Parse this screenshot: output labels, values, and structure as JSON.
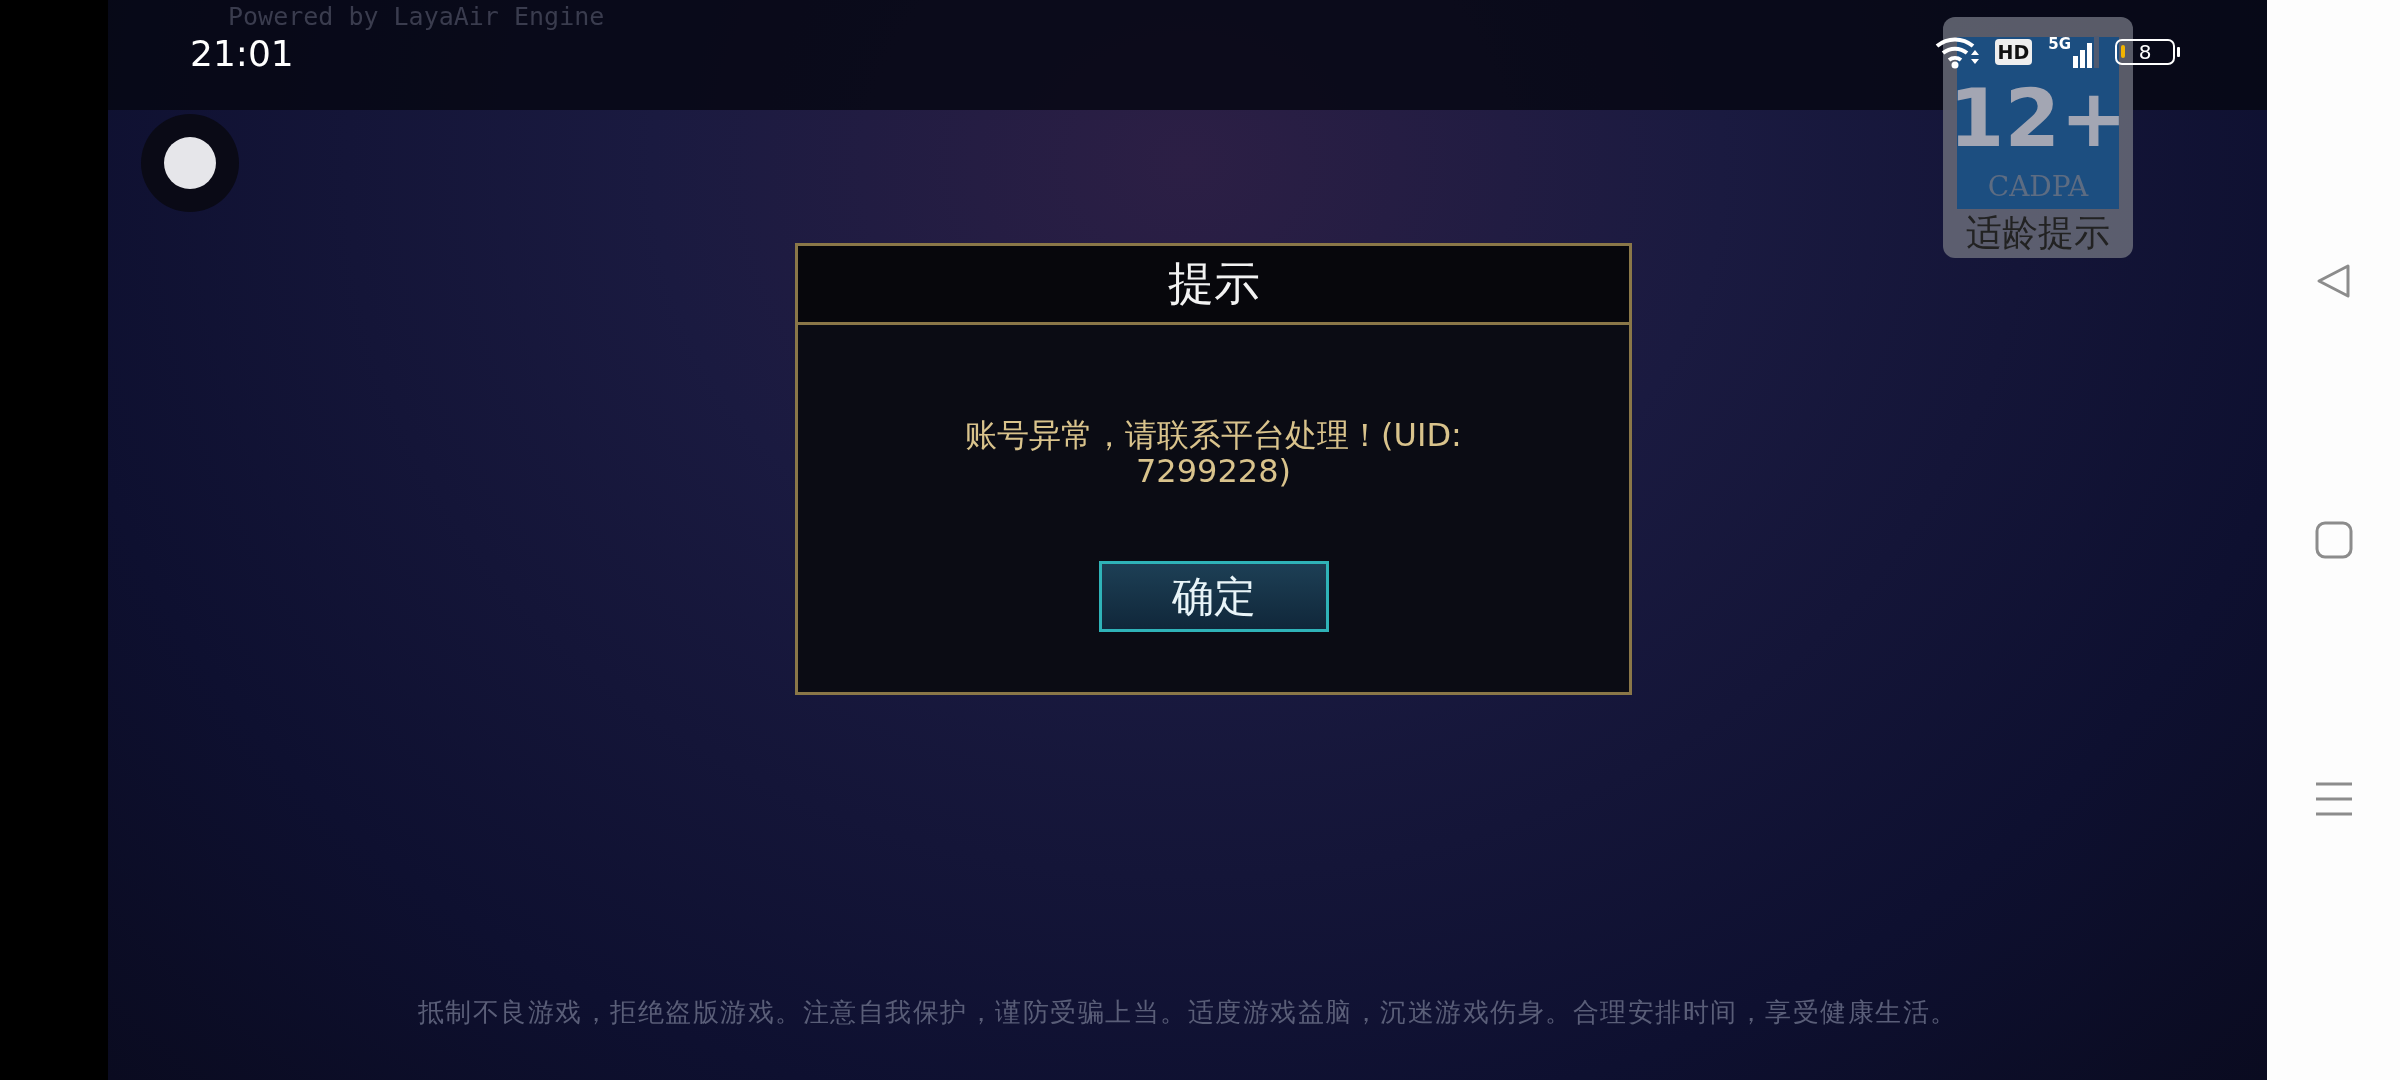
{
  "status_bar": {
    "engine_credit": "Powered by LayaAir Engine",
    "time": "21:01",
    "network_badge": "HD",
    "network_type": "5G",
    "battery": "8"
  },
  "age_rating": {
    "rating": "12+",
    "org": "CADPA",
    "label": "适龄提示"
  },
  "dialog": {
    "title": "提示",
    "message": "账号异常，请联系平台处理！(UID: 7299228)",
    "confirm_button": "确定"
  },
  "footer_notice": "抵制不良游戏，拒绝盗版游戏。注意自我保护，谨防受骗上当。适度游戏益脑，沉迷游戏伤身。合理安排时间，享受健康生活。",
  "nav_bar": {
    "buttons": [
      {
        "kind": "back"
      },
      {
        "kind": "home"
      },
      {
        "kind": "menu"
      }
    ]
  }
}
